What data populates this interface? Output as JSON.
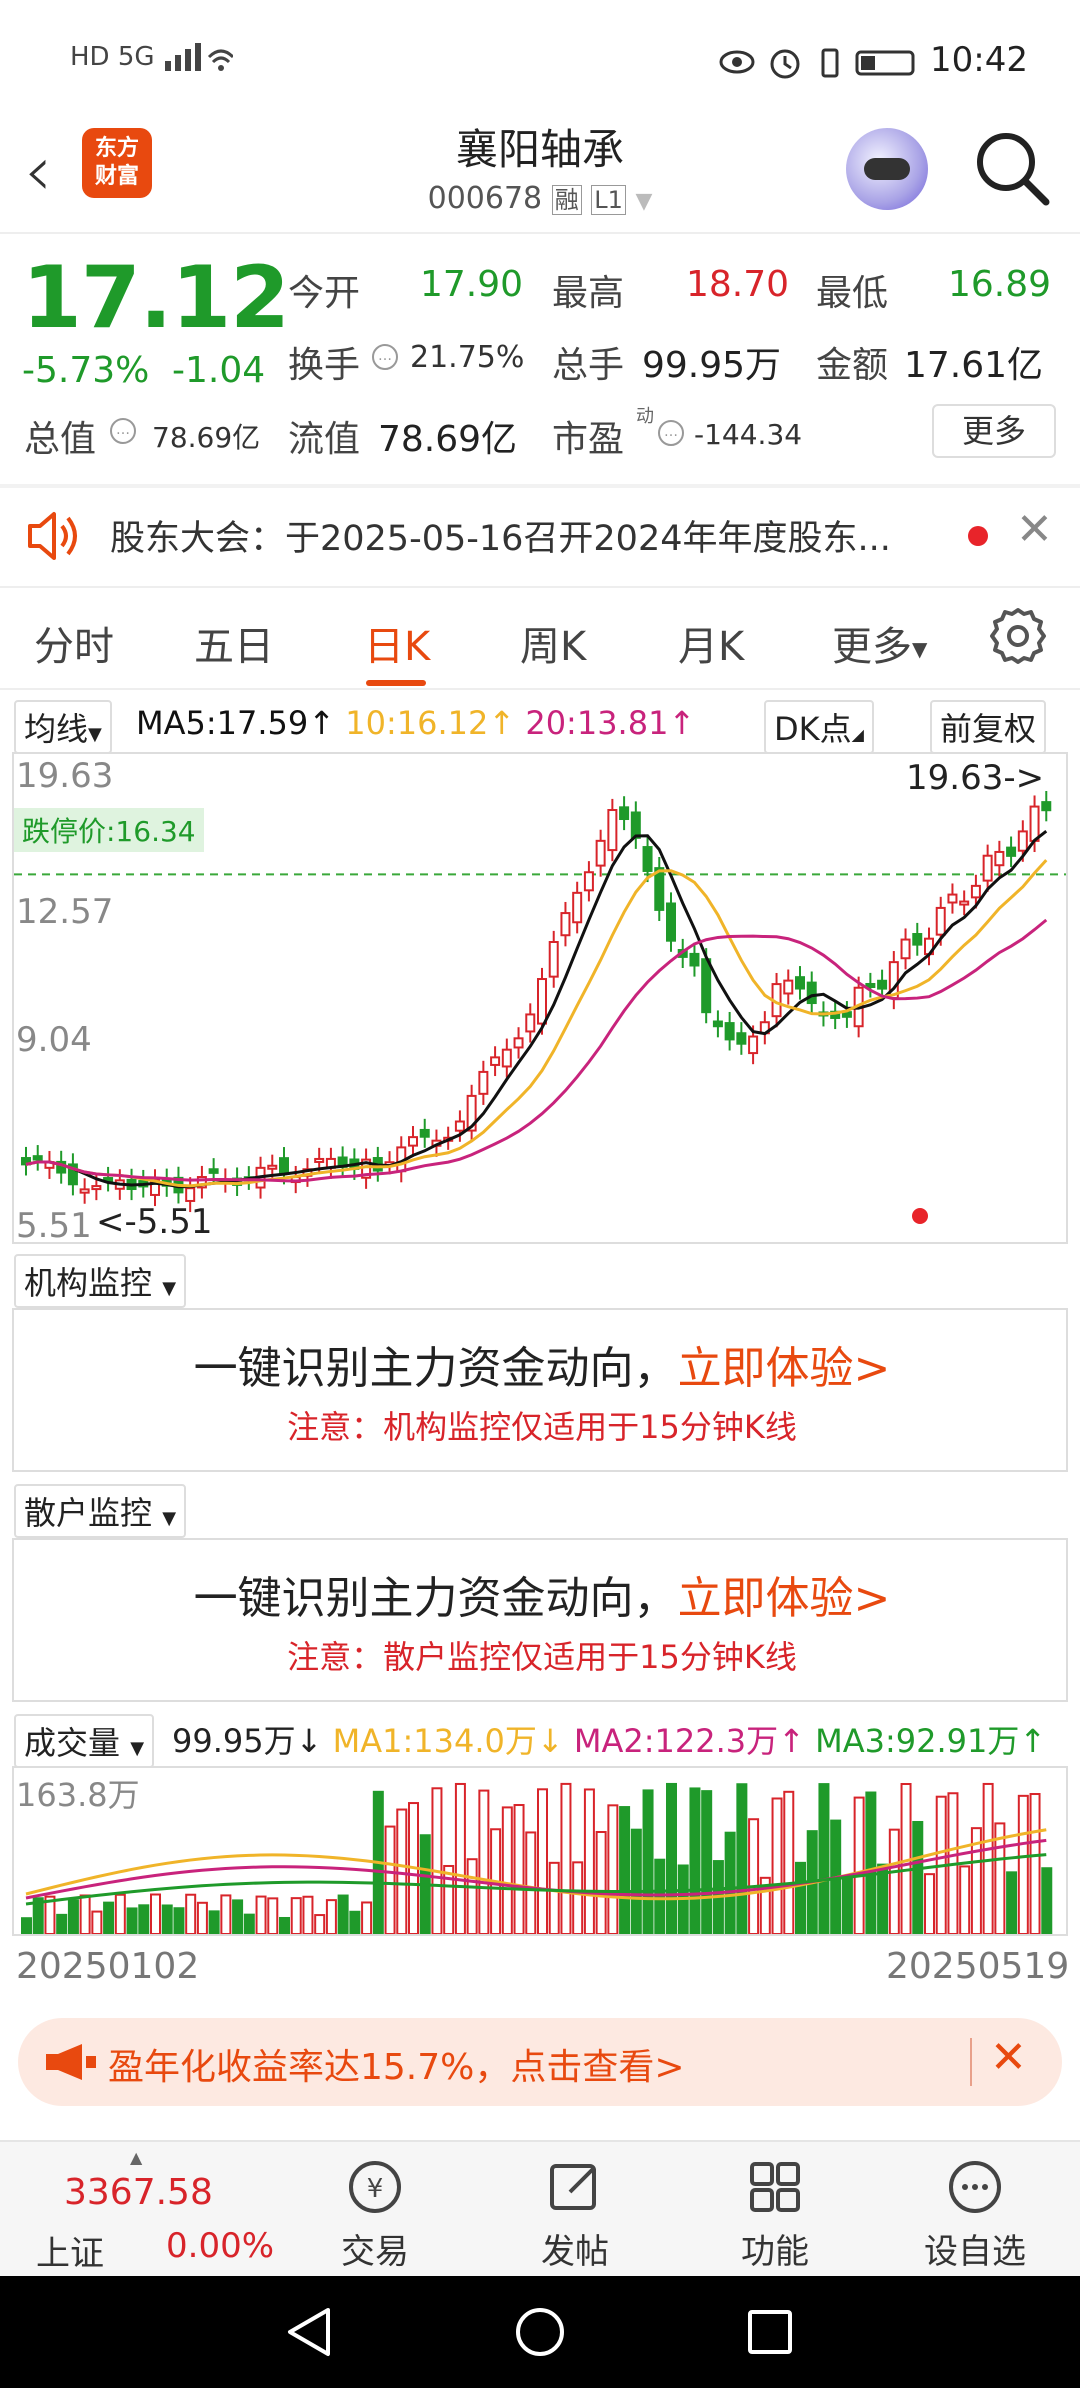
{
  "status_bar": {
    "left": "HD 5G",
    "time": "10:42"
  },
  "header": {
    "logo": "东方\n财富",
    "title": "襄阳轴承",
    "code": "000678",
    "tag1": "融",
    "tag2": "L1"
  },
  "quote": {
    "price": "17.12",
    "change_pct": "-5.73%",
    "change": "-1.04",
    "open_label": "今开",
    "open": "17.90",
    "high_label": "最高",
    "high": "18.70",
    "low_label": "最低",
    "low": "16.89",
    "turnover_label": "换手",
    "turnover": "21.75%",
    "volume_label": "总手",
    "volume": "99.95万",
    "amount_label": "金额",
    "amount": "17.61亿",
    "mktcap_label": "总值",
    "mktcap": "78.69亿",
    "float_label": "流值",
    "float": "78.69亿",
    "pe_label": "市盈",
    "pe_sup": "动",
    "pe": "-144.34",
    "more": "更多"
  },
  "notice": {
    "text": "股东大会：于2025-05-16召开2024年年度股东..."
  },
  "tabs": [
    "分时",
    "五日",
    "日K",
    "周K",
    "月K",
    "更多"
  ],
  "active_tab": "日K",
  "indicators": {
    "ma_label": "均线",
    "ma5": "MA5:17.59",
    "ma10": "10:16.12",
    "ma20": "20:13.81",
    "dk": "DK点",
    "fq": "前复权"
  },
  "kchart": {
    "y_top": "19.63",
    "y_mid": "12.57",
    "y_low": "9.04",
    "y_bottom": "5.51",
    "limit_label": "跌停价:16.34",
    "max_annot": "19.63->",
    "min_annot": "<-5.51"
  },
  "monitor1": {
    "label": "机构监控",
    "main": "一键识别主力资金动向，",
    "cta": "立即体验>",
    "note": "注意：机构监控仅适用于15分钟K线"
  },
  "monitor2": {
    "label": "散户监控",
    "main": "一键识别主力资金动向，",
    "cta": "立即体验>",
    "note": "注意：散户监控仅适用于15分钟K线"
  },
  "volume": {
    "label": "成交量",
    "value": "99.95万↓",
    "ma1": "MA1:134.0万↓",
    "ma2": "MA2:122.3万↑",
    "ma3": "MA3:92.91万↑",
    "max": "163.8万",
    "start_date": "20250102",
    "end_date": "20250519"
  },
  "banner": {
    "text": "盈年化收益率达15.7%，点击查看>"
  },
  "bottom_nav": {
    "index_name": "上证",
    "index_value": "3367.58",
    "index_change": "0.00%",
    "items": [
      "交易",
      "发帖",
      "功能",
      "设自选"
    ]
  },
  "colors": {
    "up": "#d8242a",
    "down": "#1f9a2a",
    "accent": "#e8490f",
    "ma5": "#111111",
    "ma10": "#f0b429",
    "ma20": "#c8237c"
  }
}
